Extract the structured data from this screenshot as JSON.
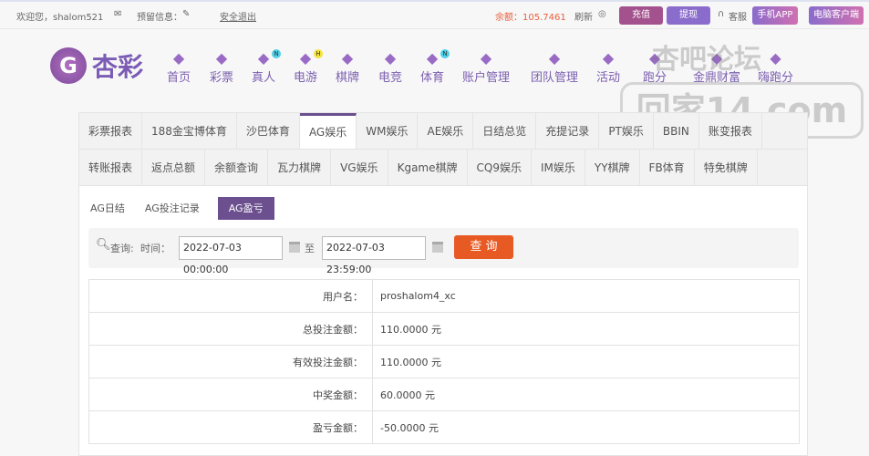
{
  "topbar": {
    "welcome": "欢迎您，shalom521",
    "reserved_label": "预留信息：",
    "logout": "安全退出",
    "balance": "余额：105.7461",
    "refresh": "刷新",
    "recharge": "充值",
    "withdraw": "提现",
    "service": "客服",
    "mobile_app": "手机APP",
    "pc_client": "电脑客户端"
  },
  "logo": {
    "mark": "G",
    "text": "杏彩"
  },
  "nav": [
    {
      "label": "首页",
      "icon": "home-icon"
    },
    {
      "label": "彩票",
      "icon": "ticket-icon"
    },
    {
      "label": "真人",
      "icon": "dealer-icon",
      "badge": "N"
    },
    {
      "label": "电游",
      "icon": "gamepad-icon",
      "badge": "H"
    },
    {
      "label": "棋牌",
      "icon": "cards-icon"
    },
    {
      "label": "电竞",
      "icon": "gamepad-icon"
    },
    {
      "label": "体育",
      "icon": "trophy-icon",
      "badge": "N"
    },
    {
      "label": "账户管理",
      "icon": "account-icon"
    },
    {
      "label": "团队管理",
      "icon": "team-icon"
    },
    {
      "label": "活动",
      "icon": "gift-icon"
    },
    {
      "label": "跑分",
      "icon": "run-icon"
    },
    {
      "label": "金鼎财富",
      "icon": "wealth-icon"
    },
    {
      "label": "嗨跑分",
      "icon": "hi-icon"
    }
  ],
  "watermark": {
    "line1": "杏吧论坛",
    "line2": "回家14.com"
  },
  "tabs_row1": [
    "彩票报表",
    "188金宝博体育",
    "沙巴体育",
    "AG娱乐",
    "WM娱乐",
    "AE娱乐",
    "日结总览",
    "充提记录",
    "PT娱乐",
    "BBIN",
    "账变报表"
  ],
  "tabs_row2": [
    "转账报表",
    "返点总额",
    "余额查询",
    "瓦力棋牌",
    "VG娱乐",
    "Kgame棋牌",
    "CQ9娱乐",
    "IM娱乐",
    "YY棋牌",
    "FB体育",
    "特免棋牌"
  ],
  "subtabs": [
    "AG日结",
    "AG投注记录",
    "AG盈亏"
  ],
  "search": {
    "query_label": "查询:",
    "time_label": "时间：",
    "start": "2022-07-03 00:00:00",
    "to": "至",
    "end": "2022-07-03 23:59:00",
    "button": "查 询"
  },
  "results": [
    {
      "k": "用户名：",
      "v": "proshalom4_xc"
    },
    {
      "k": "总投注金额：",
      "v": "110.0000 元"
    },
    {
      "k": "有效投注金额：",
      "v": "110.0000 元"
    },
    {
      "k": "中奖金额：",
      "v": "60.0000 元"
    },
    {
      "k": "盈亏金额：",
      "v": "-50.0000 元"
    }
  ]
}
